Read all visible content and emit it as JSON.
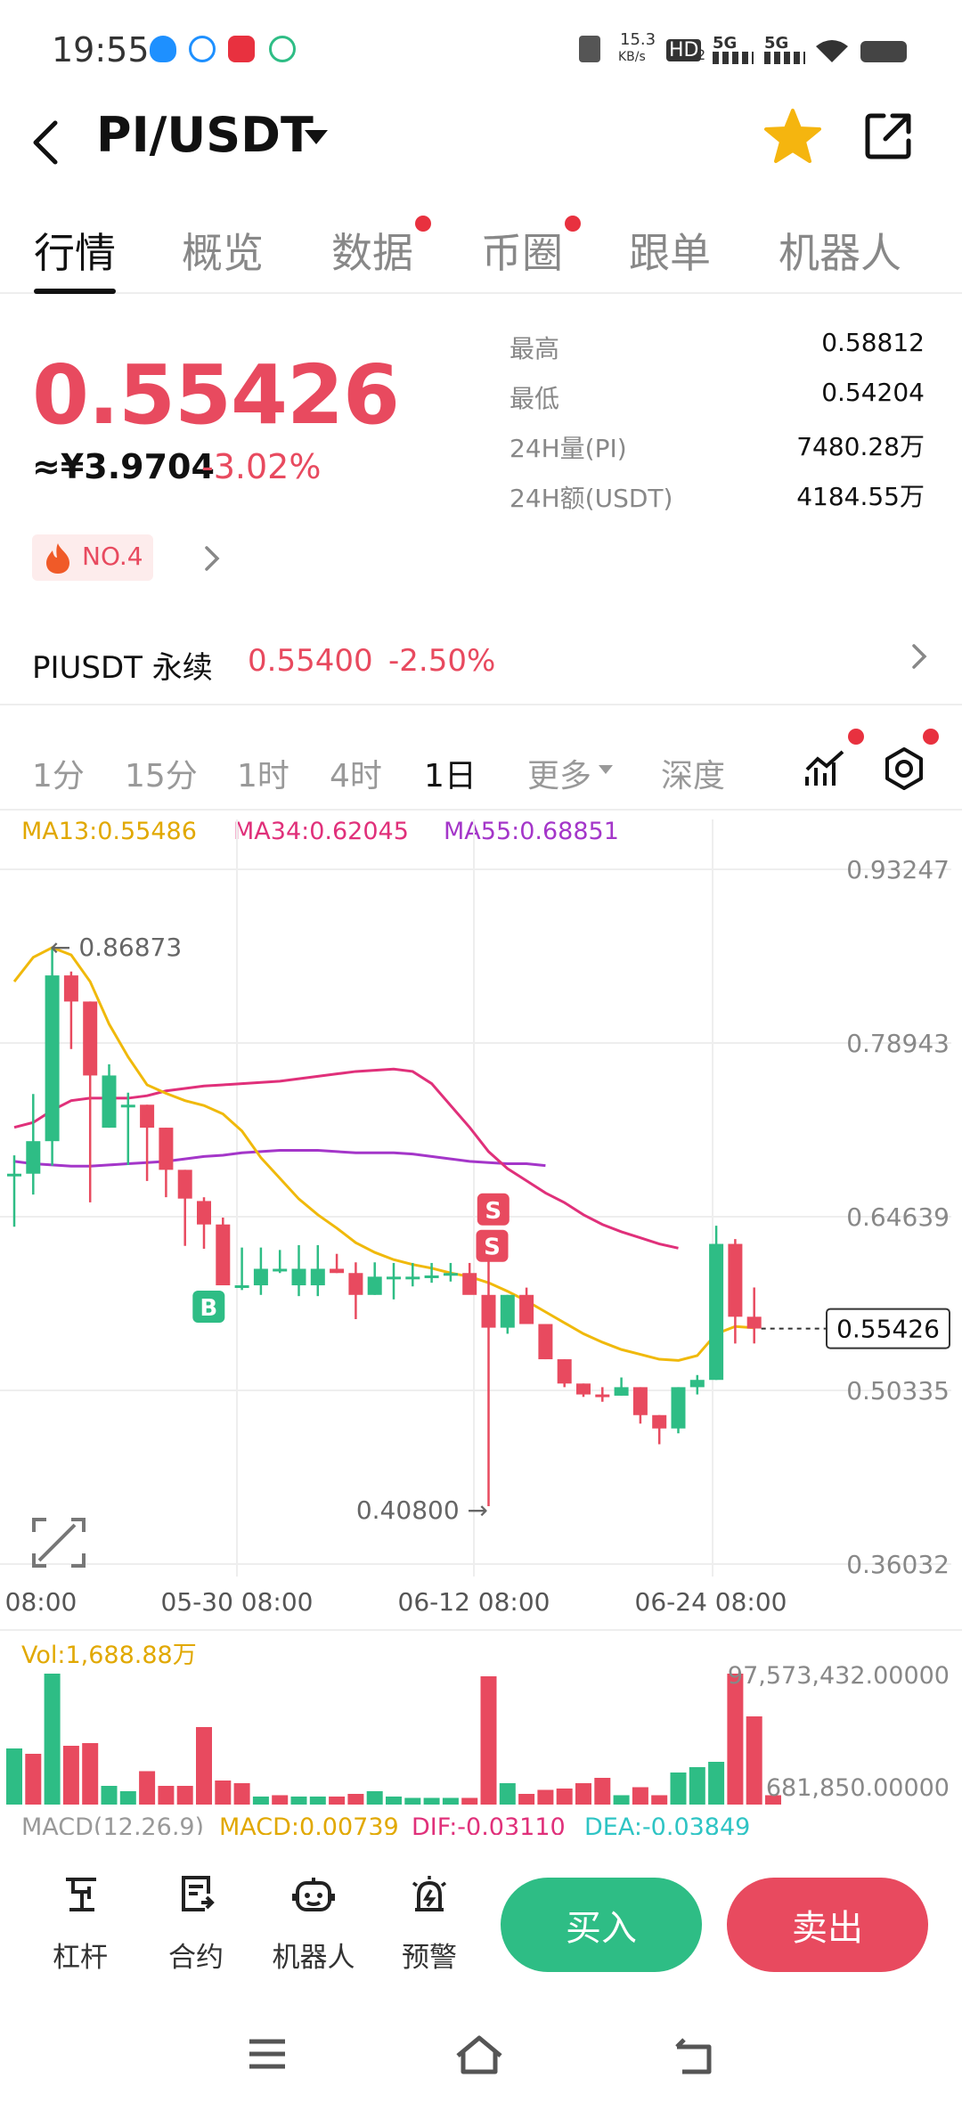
{
  "status_bar": {
    "time": "19:55",
    "net_speed": "15.3",
    "net_unit": "KB/s",
    "hd": "HD",
    "hd_sub": "2",
    "sig1": "5G",
    "sig2": "5G"
  },
  "header": {
    "pair": "PI/USDT"
  },
  "tabs": [
    {
      "label": "行情",
      "active": true,
      "dot": false
    },
    {
      "label": "概览",
      "active": false,
      "dot": false
    },
    {
      "label": "数据",
      "active": false,
      "dot": true
    },
    {
      "label": "币圈",
      "active": false,
      "dot": true
    },
    {
      "label": "跟单",
      "active": false,
      "dot": false
    },
    {
      "label": "机器人",
      "active": false,
      "dot": false
    }
  ],
  "ticker": {
    "price": "0.55426",
    "cny": "≈¥3.9704",
    "change": "-3.02%",
    "rank": "NO.4",
    "stats": [
      {
        "label": "最高",
        "value": "0.58812"
      },
      {
        "label": "最低",
        "value": "0.54204"
      },
      {
        "label": "24H量(PI)",
        "value": "7480.28万"
      },
      {
        "label": "24H额(USDT)",
        "value": "4184.55万"
      }
    ],
    "perpetual": {
      "label": "PIUSDT 永续",
      "price": "0.55400",
      "change": "-2.50%"
    }
  },
  "intervals": {
    "items": [
      "1分",
      "15分",
      "1时",
      "4时",
      "1日",
      "更多",
      "深度"
    ],
    "active": "1日"
  },
  "chart_data": {
    "type": "candlestick",
    "ma_labels": {
      "ma13": "MA13:0.55486",
      "ma34": "MA34:0.62045",
      "ma55": "MA55:0.68851"
    },
    "colors": {
      "up": "#2ebd85",
      "down": "#e84a5f",
      "ma13": "#f0b90b",
      "ma34": "#e0307a",
      "ma55": "#a436c9"
    },
    "y_ticks": [
      "0.93247",
      "0.78943",
      "0.64639",
      "0.50335",
      "0.36032"
    ],
    "ylim": [
      0.36032,
      0.93247
    ],
    "x_labels": [
      "08:00",
      "05-30 08:00",
      "06-12 08:00",
      "06-24 08:00"
    ],
    "high_label": "← 0.86873",
    "low_label": "0.40800 →",
    "last_price": "0.55426",
    "candles": [
      {
        "o": 0.6818,
        "h": 0.6969,
        "l": 0.6381,
        "c": 0.6818
      },
      {
        "o": 0.6818,
        "h": 0.7474,
        "l": 0.6646,
        "c": 0.7086
      },
      {
        "o": 0.7086,
        "h": 0.8682,
        "l": 0.6885,
        "c": 0.8451
      },
      {
        "o": 0.8451,
        "h": 0.8483,
        "l": 0.7845,
        "c": 0.8236
      },
      {
        "o": 0.8236,
        "h": 0.8236,
        "l": 0.6582,
        "c": 0.7627
      },
      {
        "o": 0.7197,
        "h": 0.7719,
        "l": 0.7197,
        "c": 0.7627
      },
      {
        "o": 0.7386,
        "h": 0.7485,
        "l": 0.6889,
        "c": 0.7386
      },
      {
        "o": 0.7386,
        "h": 0.7386,
        "l": 0.6758,
        "c": 0.7197
      },
      {
        "o": 0.7197,
        "h": 0.7197,
        "l": 0.6624,
        "c": 0.685
      },
      {
        "o": 0.685,
        "h": 0.685,
        "l": 0.6224,
        "c": 0.6613
      },
      {
        "o": 0.6593,
        "h": 0.6624,
        "l": 0.62,
        "c": 0.64
      },
      {
        "o": 0.64,
        "h": 0.6457,
        "l": 0.5899,
        "c": 0.5899
      },
      {
        "o": 0.5899,
        "h": 0.621,
        "l": 0.586,
        "c": 0.5899
      },
      {
        "o": 0.5899,
        "h": 0.621,
        "l": 0.582,
        "c": 0.6035
      },
      {
        "o": 0.6035,
        "h": 0.619,
        "l": 0.6,
        "c": 0.6035
      },
      {
        "o": 0.5899,
        "h": 0.623,
        "l": 0.581,
        "c": 0.6035
      },
      {
        "o": 0.5899,
        "h": 0.623,
        "l": 0.581,
        "c": 0.6035
      },
      {
        "o": 0.6035,
        "h": 0.6158,
        "l": 0.6,
        "c": 0.6
      },
      {
        "o": 0.6,
        "h": 0.6088,
        "l": 0.562,
        "c": 0.582
      },
      {
        "o": 0.582,
        "h": 0.6088,
        "l": 0.582,
        "c": 0.597
      },
      {
        "o": 0.597,
        "h": 0.6083,
        "l": 0.5783,
        "c": 0.597
      },
      {
        "o": 0.597,
        "h": 0.6083,
        "l": 0.589,
        "c": 0.597
      },
      {
        "o": 0.597,
        "h": 0.6083,
        "l": 0.592,
        "c": 0.598
      },
      {
        "o": 0.598,
        "h": 0.6083,
        "l": 0.593,
        "c": 0.6
      },
      {
        "o": 0.6,
        "h": 0.6083,
        "l": 0.588,
        "c": 0.582
      },
      {
        "o": 0.582,
        "h": 0.62,
        "l": 0.408,
        "c": 0.555
      },
      {
        "o": 0.555,
        "h": 0.582,
        "l": 0.55,
        "c": 0.582
      },
      {
        "o": 0.582,
        "h": 0.588,
        "l": 0.558,
        "c": 0.558
      },
      {
        "o": 0.558,
        "h": 0.558,
        "l": 0.529,
        "c": 0.529
      },
      {
        "o": 0.529,
        "h": 0.529,
        "l": 0.506,
        "c": 0.509
      },
      {
        "o": 0.509,
        "h": 0.509,
        "l": 0.498,
        "c": 0.5
      },
      {
        "o": 0.5,
        "h": 0.506,
        "l": 0.494,
        "c": 0.499
      },
      {
        "o": 0.499,
        "h": 0.514,
        "l": 0.499,
        "c": 0.506
      },
      {
        "o": 0.506,
        "h": 0.506,
        "l": 0.476,
        "c": 0.483
      },
      {
        "o": 0.483,
        "h": 0.483,
        "l": 0.459,
        "c": 0.472
      },
      {
        "o": 0.472,
        "h": 0.506,
        "l": 0.468,
        "c": 0.506
      },
      {
        "o": 0.506,
        "h": 0.516,
        "l": 0.5,
        "c": 0.512
      },
      {
        "o": 0.512,
        "h": 0.639,
        "l": 0.512,
        "c": 0.624
      },
      {
        "o": 0.624,
        "h": 0.628,
        "l": 0.542,
        "c": 0.564
      },
      {
        "o": 0.564,
        "h": 0.5881,
        "l": 0.542,
        "c": 0.5543
      }
    ],
    "ma13": [
      0.84,
      0.86,
      0.868,
      0.862,
      0.84,
      0.805,
      0.778,
      0.755,
      0.748,
      0.742,
      0.738,
      0.731,
      0.717,
      0.695,
      0.678,
      0.661,
      0.648,
      0.637,
      0.625,
      0.617,
      0.611,
      0.607,
      0.604,
      0.6,
      0.597,
      0.592,
      0.585,
      0.577,
      0.568,
      0.559,
      0.55,
      0.543,
      0.537,
      0.533,
      0.529,
      0.528,
      0.532,
      0.55,
      0.556,
      0.5549
    ],
    "ma34": [
      0.72,
      0.724,
      0.734,
      0.742,
      0.744,
      0.744,
      0.744,
      0.746,
      0.75,
      0.752,
      0.754,
      0.755,
      0.756,
      0.757,
      0.758,
      0.76,
      0.762,
      0.764,
      0.766,
      0.767,
      0.768,
      0.766,
      0.756,
      0.738,
      0.72,
      0.7,
      0.686,
      0.676,
      0.666,
      0.658,
      0.648,
      0.64,
      0.634,
      0.629,
      0.624,
      0.6205
    ],
    "ma55": [
      0.692,
      0.69,
      0.689,
      0.688,
      0.688,
      0.689,
      0.69,
      0.691,
      0.692,
      0.694,
      0.696,
      0.697,
      0.699,
      0.7,
      0.701,
      0.701,
      0.701,
      0.7,
      0.699,
      0.699,
      0.699,
      0.698,
      0.696,
      0.694,
      0.692,
      0.691,
      0.69,
      0.69,
      0.6885
    ],
    "signals": [
      {
        "label": "B",
        "type": "buy"
      },
      {
        "label": "S",
        "type": "sell"
      },
      {
        "label": "S",
        "type": "sell"
      }
    ],
    "volume": {
      "label": "Vol:1,688.88万",
      "max_label": "97,573,432.00000",
      "min_label": "681,850.00000",
      "values": [
        0.42,
        0.38,
        0.98,
        0.44,
        0.46,
        0.14,
        0.1,
        0.25,
        0.14,
        0.14,
        0.58,
        0.18,
        0.16,
        0.06,
        0.07,
        0.06,
        0.06,
        0.06,
        0.08,
        0.1,
        0.06,
        0.05,
        0.05,
        0.05,
        0.05,
        0.96,
        0.16,
        0.08,
        0.11,
        0.12,
        0.16,
        0.2,
        0.07,
        0.13,
        0.07,
        0.24,
        0.28,
        0.32,
        0.98,
        0.66,
        0.07
      ],
      "up": [
        true,
        false,
        true,
        false,
        false,
        true,
        true,
        false,
        false,
        false,
        false,
        false,
        false,
        true,
        false,
        true,
        true,
        false,
        false,
        true,
        true,
        true,
        true,
        true,
        false,
        false,
        true,
        false,
        false,
        false,
        false,
        false,
        true,
        false,
        false,
        true,
        true,
        true,
        false,
        false,
        false
      ]
    },
    "macd_label": {
      "name": "MACD(12,26,9)",
      "macd": "MACD:0.00739",
      "dif": "DIF:-0.03110",
      "dea": "DEA:-0.03849"
    }
  },
  "bottom_bar": {
    "items": [
      {
        "label": "杠杆",
        "icon": "leverage-icon"
      },
      {
        "label": "合约",
        "icon": "contract-icon"
      },
      {
        "label": "机器人",
        "icon": "robot-icon"
      },
      {
        "label": "预警",
        "icon": "alert-icon"
      }
    ],
    "buy": "买入",
    "sell": "卖出"
  }
}
